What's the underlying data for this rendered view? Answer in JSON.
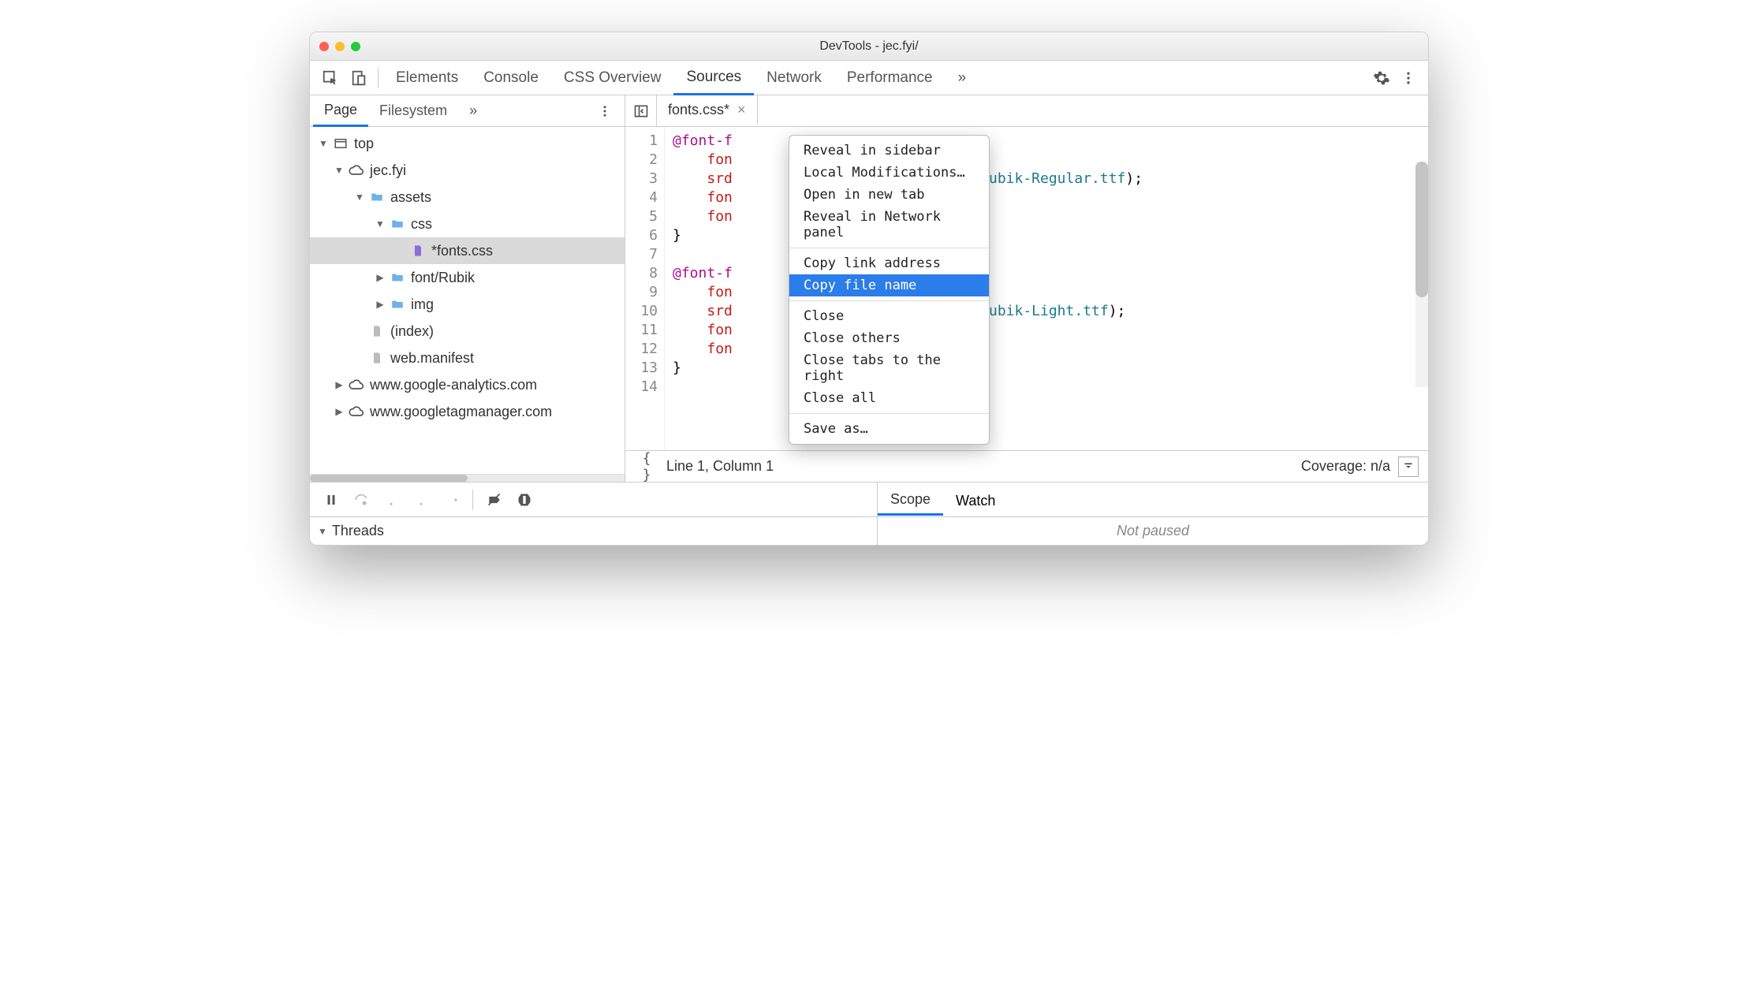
{
  "window_title": "DevTools - jec.fyi/",
  "main_tabs": {
    "items": [
      "Elements",
      "Console",
      "CSS Overview",
      "Sources",
      "Network",
      "Performance"
    ],
    "active": "Sources",
    "overflow": "»"
  },
  "side": {
    "tabs": [
      "Page",
      "Filesystem"
    ],
    "active": "Page",
    "overflow": "»",
    "tree": {
      "top": "top",
      "domain": "jec.fyi",
      "assets": "assets",
      "css": "css",
      "fonts_file": "*fonts.css",
      "font_rubik": "font/Rubik",
      "img": "img",
      "index": "(index)",
      "manifest": "web.manifest",
      "ga": "www.google-analytics.com",
      "gtm": "www.googletagmanager.com"
    }
  },
  "file_tab": {
    "name": "fonts.css*",
    "close": "×"
  },
  "line_numbers": [
    "1",
    "2",
    "3",
    "4",
    "5",
    "6",
    "7",
    "8",
    "9",
    "10",
    "11",
    "12",
    "13",
    "14"
  ],
  "code": {
    "l1a": "@font-f",
    "l2": "fon",
    "l3a": "srd",
    "l3b": "Rubik/Rubik-Regular.ttf",
    "l3c": ");",
    "l4": "fon",
    "l5": "fon",
    "l6": "}",
    "l7": "",
    "l8": "@font-f",
    "l9": "fon",
    "l10a": "srd",
    "l10b": "Rubik/Rubik-Light.ttf",
    "l10c": ");",
    "l11": "fon",
    "l12": "fon",
    "l13": "}"
  },
  "context_menu": {
    "items": [
      "Reveal in sidebar",
      "Local Modifications…",
      "Open in new tab",
      "Reveal in Network panel",
      "Copy link address",
      "Copy file name",
      "Close",
      "Close others",
      "Close tabs to the right",
      "Close all",
      "Save as…"
    ],
    "highlighted": "Copy file name"
  },
  "status": {
    "pretty": "{ }",
    "pos": "Line 1, Column 1",
    "coverage": "Coverage: n/a"
  },
  "debug_tabs": [
    "Scope",
    "Watch"
  ],
  "threads_label": "Threads",
  "not_paused": "Not paused"
}
